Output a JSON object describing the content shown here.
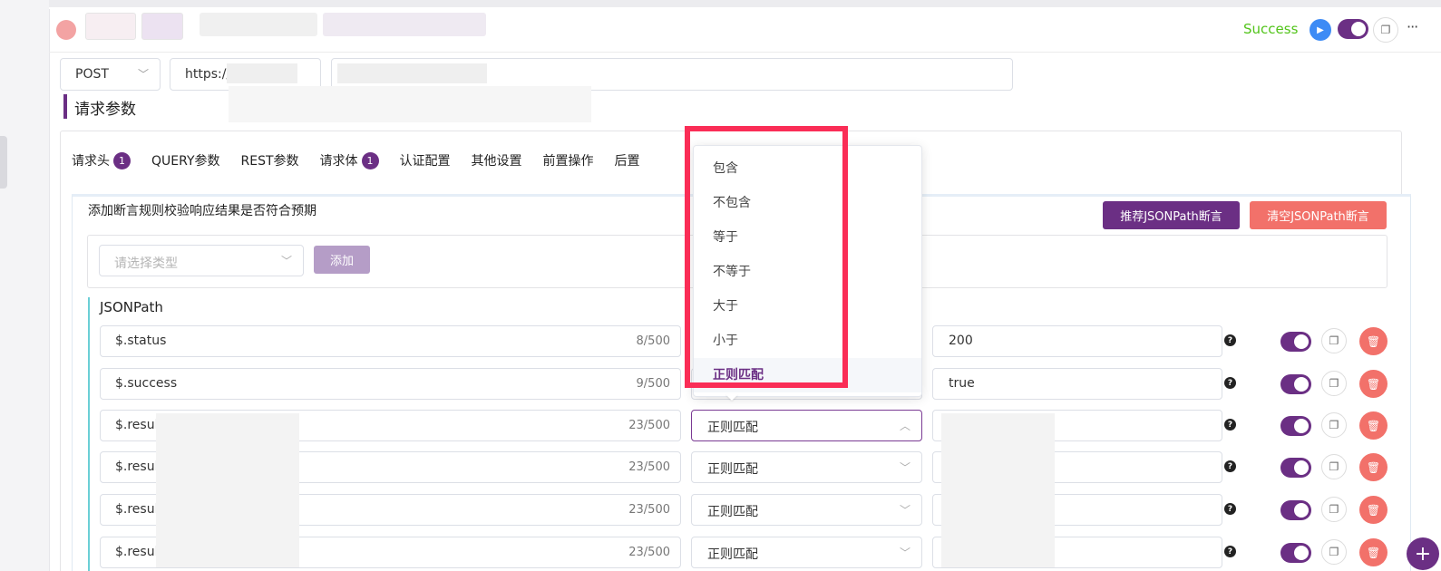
{
  "header": {
    "status": "Success",
    "more_label": "···"
  },
  "url_bar": {
    "method": "POST",
    "url_prefix": "https://"
  },
  "section_title": "请求参数",
  "tabs": [
    {
      "label": "请求头",
      "badge": "1"
    },
    {
      "label": "QUERY参数",
      "badge": null
    },
    {
      "label": "REST参数",
      "badge": null
    },
    {
      "label": "请求体",
      "badge": "1"
    },
    {
      "label": "认证配置",
      "badge": null
    },
    {
      "label": "其他设置",
      "badge": null
    },
    {
      "label": "前置操作",
      "badge": null
    },
    {
      "label": "后置",
      "badge": null
    }
  ],
  "assert": {
    "description": "添加断言规则校验响应结果是否符合预期",
    "recommend_button": "推荐JSONPath断言",
    "clear_button": "清空JSONPath断言",
    "type_placeholder": "请选择类型",
    "add_button": "添加",
    "jsonpath_title": "JSONPath"
  },
  "rows": [
    {
      "path": "$.status",
      "count": "8/500",
      "operator": "",
      "value": "200"
    },
    {
      "path": "$.success",
      "count": "9/500",
      "operator": "",
      "value": "true"
    },
    {
      "path": "$.resul",
      "count": "23/500",
      "operator": "正则匹配",
      "value": ""
    },
    {
      "path": "$.resul",
      "count": "23/500",
      "operator": "正则匹配",
      "value": ""
    },
    {
      "path": "$.resul",
      "count": "23/500",
      "operator": "正则匹配",
      "value": ""
    },
    {
      "path": "$.resul",
      "count": "23/500",
      "operator": "正则匹配",
      "value": ""
    }
  ],
  "dropdown": {
    "options": [
      "包含",
      "不包含",
      "等于",
      "不等于",
      "大于",
      "小于",
      "正则匹配"
    ],
    "selected": "正则匹配"
  },
  "colors": {
    "brand": "#6b2f84",
    "danger": "#f2716a",
    "success": "#52c41a",
    "highlight": "#fa2d56"
  }
}
